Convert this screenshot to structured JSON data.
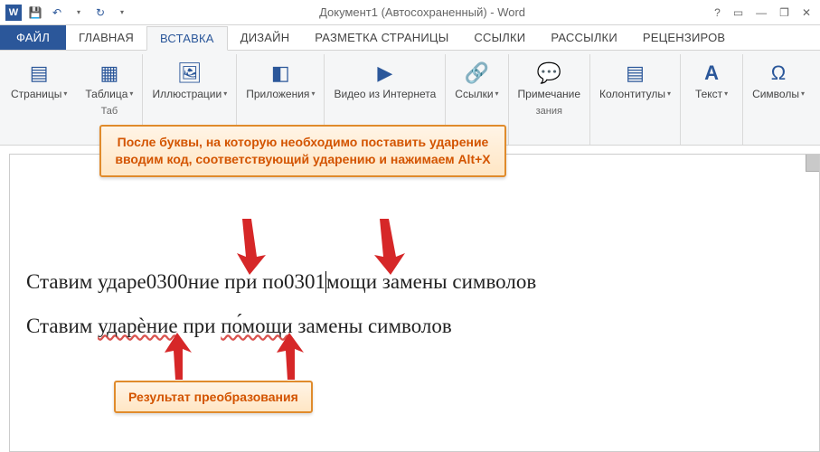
{
  "title": "Документ1 (Автосохраненный) - Word",
  "qat": {
    "word_icon": "W",
    "save": "💾",
    "undo": "↶",
    "redo": "↻"
  },
  "win": {
    "help": "?",
    "ribbon": "▭",
    "min": "—",
    "max": "❐",
    "close": "✕"
  },
  "tabs": {
    "file": "ФАЙЛ",
    "home": "ГЛАВНАЯ",
    "insert": "ВСТАВКА",
    "design": "ДИЗАЙН",
    "layout": "РАЗМЕТКА СТРАНИЦЫ",
    "references": "ССЫЛКИ",
    "mailings": "РАССЫЛКИ",
    "review": "РЕЦЕНЗИРОВ"
  },
  "ribbon": {
    "pages": "Страницы",
    "table": "Таблица",
    "tables_group": "Таб",
    "illustrations": "Иллюстрации",
    "apps": "Приложения",
    "video": "Видео из Интернета",
    "links": "Ссылки",
    "comment": "Примечание",
    "comment_group": "зания",
    "headerfooter": "Колонтитулы",
    "text": "Текст",
    "symbols": "Символы"
  },
  "doc": {
    "line1_a": "Ставим ударе0300ние при по0301",
    "line1_b": "мощи замены символов",
    "line2_a": "Ставим ",
    "line2_b": "ударѐние",
    "line2_c": " при ",
    "line2_d": "по́мощи",
    "line2_e": " замены символов"
  },
  "callout_top": "После буквы, на которую необходимо поставить ударение вводим код, соответствующий ударению и нажимаем Alt+X",
  "callout_bottom": "Результат преобразования"
}
